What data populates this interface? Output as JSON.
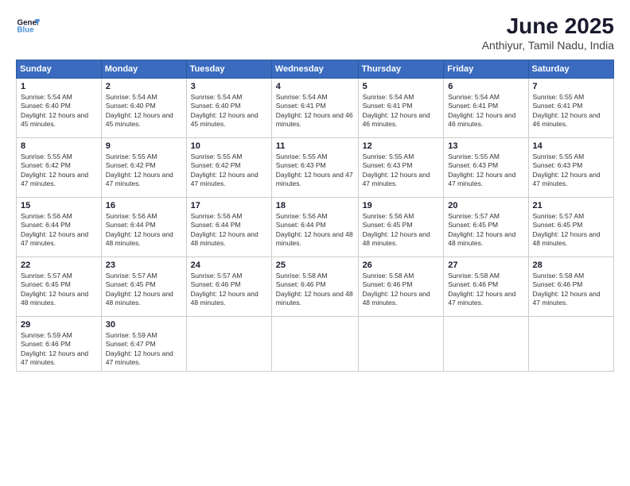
{
  "logo": {
    "line1": "General",
    "line2": "Blue"
  },
  "title": "June 2025",
  "location": "Anthiyur, Tamil Nadu, India",
  "weekdays": [
    "Sunday",
    "Monday",
    "Tuesday",
    "Wednesday",
    "Thursday",
    "Friday",
    "Saturday"
  ],
  "weeks": [
    [
      {
        "day": "1",
        "sunrise": "5:54 AM",
        "sunset": "6:40 PM",
        "daylight": "12 hours and 45 minutes."
      },
      {
        "day": "2",
        "sunrise": "5:54 AM",
        "sunset": "6:40 PM",
        "daylight": "12 hours and 45 minutes."
      },
      {
        "day": "3",
        "sunrise": "5:54 AM",
        "sunset": "6:40 PM",
        "daylight": "12 hours and 45 minutes."
      },
      {
        "day": "4",
        "sunrise": "5:54 AM",
        "sunset": "6:41 PM",
        "daylight": "12 hours and 46 minutes."
      },
      {
        "day": "5",
        "sunrise": "5:54 AM",
        "sunset": "6:41 PM",
        "daylight": "12 hours and 46 minutes."
      },
      {
        "day": "6",
        "sunrise": "5:54 AM",
        "sunset": "6:41 PM",
        "daylight": "12 hours and 46 minutes."
      },
      {
        "day": "7",
        "sunrise": "5:55 AM",
        "sunset": "6:41 PM",
        "daylight": "12 hours and 46 minutes."
      }
    ],
    [
      {
        "day": "8",
        "sunrise": "5:55 AM",
        "sunset": "6:42 PM",
        "daylight": "12 hours and 47 minutes."
      },
      {
        "day": "9",
        "sunrise": "5:55 AM",
        "sunset": "6:42 PM",
        "daylight": "12 hours and 47 minutes."
      },
      {
        "day": "10",
        "sunrise": "5:55 AM",
        "sunset": "6:42 PM",
        "daylight": "12 hours and 47 minutes."
      },
      {
        "day": "11",
        "sunrise": "5:55 AM",
        "sunset": "6:43 PM",
        "daylight": "12 hours and 47 minutes."
      },
      {
        "day": "12",
        "sunrise": "5:55 AM",
        "sunset": "6:43 PM",
        "daylight": "12 hours and 47 minutes."
      },
      {
        "day": "13",
        "sunrise": "5:55 AM",
        "sunset": "6:43 PM",
        "daylight": "12 hours and 47 minutes."
      },
      {
        "day": "14",
        "sunrise": "5:55 AM",
        "sunset": "6:43 PM",
        "daylight": "12 hours and 47 minutes."
      }
    ],
    [
      {
        "day": "15",
        "sunrise": "5:56 AM",
        "sunset": "6:44 PM",
        "daylight": "12 hours and 47 minutes."
      },
      {
        "day": "16",
        "sunrise": "5:56 AM",
        "sunset": "6:44 PM",
        "daylight": "12 hours and 48 minutes."
      },
      {
        "day": "17",
        "sunrise": "5:56 AM",
        "sunset": "6:44 PM",
        "daylight": "12 hours and 48 minutes."
      },
      {
        "day": "18",
        "sunrise": "5:56 AM",
        "sunset": "6:44 PM",
        "daylight": "12 hours and 48 minutes."
      },
      {
        "day": "19",
        "sunrise": "5:56 AM",
        "sunset": "6:45 PM",
        "daylight": "12 hours and 48 minutes."
      },
      {
        "day": "20",
        "sunrise": "5:57 AM",
        "sunset": "6:45 PM",
        "daylight": "12 hours and 48 minutes."
      },
      {
        "day": "21",
        "sunrise": "5:57 AM",
        "sunset": "6:45 PM",
        "daylight": "12 hours and 48 minutes."
      }
    ],
    [
      {
        "day": "22",
        "sunrise": "5:57 AM",
        "sunset": "6:45 PM",
        "daylight": "12 hours and 48 minutes."
      },
      {
        "day": "23",
        "sunrise": "5:57 AM",
        "sunset": "6:45 PM",
        "daylight": "12 hours and 48 minutes."
      },
      {
        "day": "24",
        "sunrise": "5:57 AM",
        "sunset": "6:46 PM",
        "daylight": "12 hours and 48 minutes."
      },
      {
        "day": "25",
        "sunrise": "5:58 AM",
        "sunset": "6:46 PM",
        "daylight": "12 hours and 48 minutes."
      },
      {
        "day": "26",
        "sunrise": "5:58 AM",
        "sunset": "6:46 PM",
        "daylight": "12 hours and 48 minutes."
      },
      {
        "day": "27",
        "sunrise": "5:58 AM",
        "sunset": "6:46 PM",
        "daylight": "12 hours and 47 minutes."
      },
      {
        "day": "28",
        "sunrise": "5:58 AM",
        "sunset": "6:46 PM",
        "daylight": "12 hours and 47 minutes."
      }
    ],
    [
      {
        "day": "29",
        "sunrise": "5:59 AM",
        "sunset": "6:46 PM",
        "daylight": "12 hours and 47 minutes."
      },
      {
        "day": "30",
        "sunrise": "5:59 AM",
        "sunset": "6:47 PM",
        "daylight": "12 hours and 47 minutes."
      },
      null,
      null,
      null,
      null,
      null
    ]
  ]
}
